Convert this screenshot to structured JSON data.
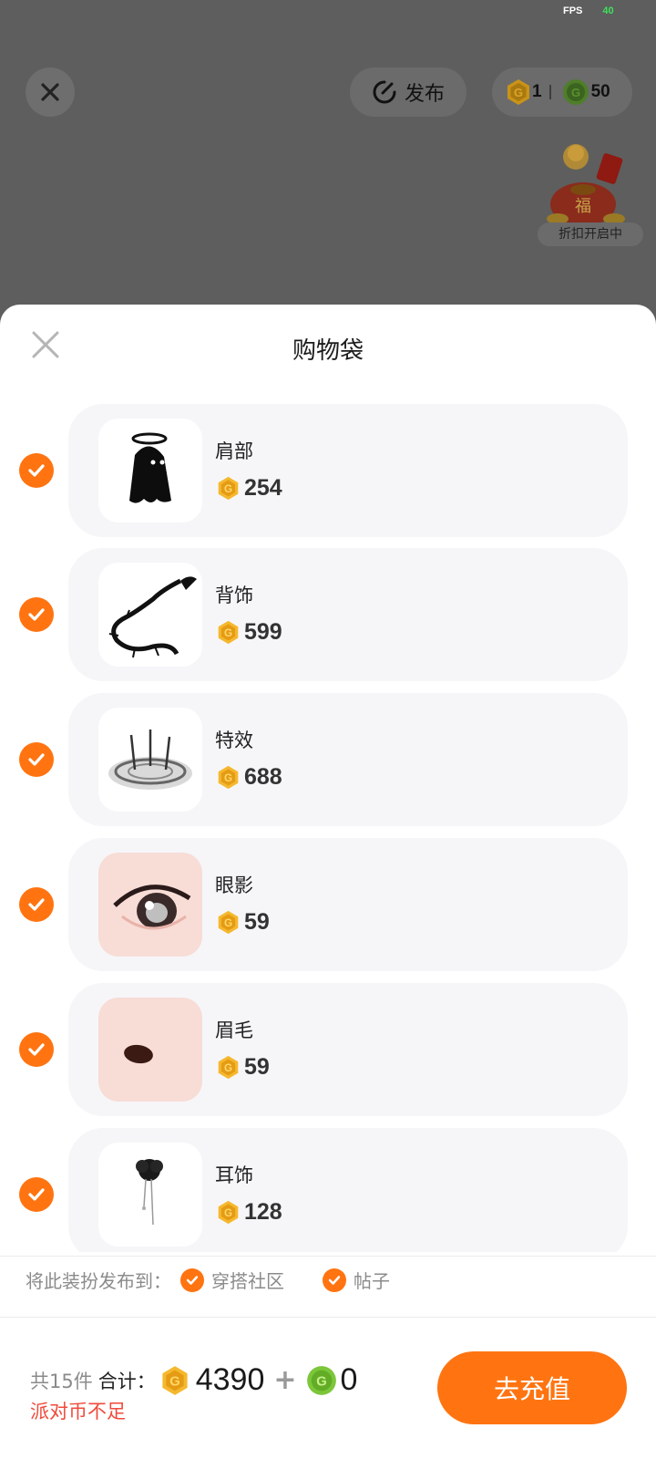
{
  "status": {
    "fps_label": "FPS",
    "fps_value": "40"
  },
  "topbar": {
    "publish_label": "发布",
    "gold_balance": "1",
    "green_balance": "50"
  },
  "promo": {
    "label": "折扣开启中",
    "badge_char": "福"
  },
  "sheet": {
    "title": "购物袋",
    "items": [
      {
        "name": "肩部",
        "price": "254"
      },
      {
        "name": "背饰",
        "price": "599"
      },
      {
        "name": "特效",
        "price": "688"
      },
      {
        "name": "眼影",
        "price": "59"
      },
      {
        "name": "眉毛",
        "price": "59"
      },
      {
        "name": "耳饰",
        "price": "128"
      }
    ]
  },
  "footer": {
    "publish_to_label": "将此装扮发布到：",
    "option_community": "穿搭社区",
    "option_post": "帖子",
    "count_label": "共15件",
    "total_label": "合计：",
    "gold_total": "4390",
    "plus": "+",
    "green_total": "0",
    "warning": "派对币不足",
    "recharge_label": "去充值"
  },
  "colors": {
    "accent": "#ff7411",
    "gold": "#f5b82e",
    "green": "#7cc63a",
    "warning": "#f04a3b"
  }
}
